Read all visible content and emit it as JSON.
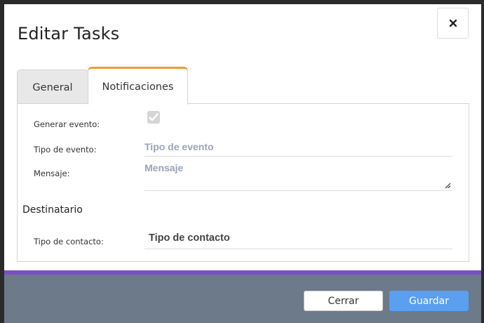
{
  "dialog": {
    "title": "Editar Tasks",
    "close_icon": "close-icon"
  },
  "tabs": [
    {
      "label": "General",
      "active": false
    },
    {
      "label": "Notificaciones",
      "active": true
    }
  ],
  "form": {
    "generar_evento": {
      "label": "Generar evento:",
      "checked": true,
      "disabled": true
    },
    "tipo_evento": {
      "label": "Tipo de evento:",
      "placeholder": "Tipo de evento",
      "value": ""
    },
    "mensaje": {
      "label": "Mensaje:",
      "placeholder": "Mensaje",
      "value": ""
    },
    "destinatario_title": "Destinatario",
    "tipo_contacto": {
      "label": "Tipo de contacto:",
      "value": "Tipo de contacto"
    }
  },
  "footer": {
    "cerrar_label": "Cerrar",
    "guardar_label": "Guardar"
  },
  "colors": {
    "accent_tab": "#f29a2e",
    "footer_accent": "#7b4fc4",
    "footer_bg": "#6c7a89",
    "primary_button": "#5a9ff0"
  }
}
